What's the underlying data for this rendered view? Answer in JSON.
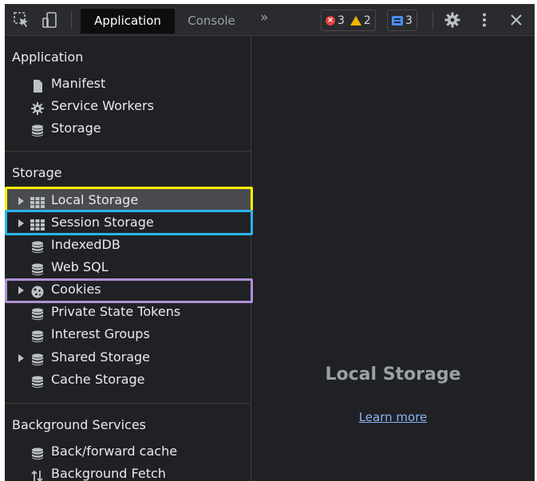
{
  "toolbar": {
    "tabs": [
      {
        "label": "Application",
        "active": true
      },
      {
        "label": "Console",
        "active": false
      }
    ],
    "more_tabs": "»",
    "errors_count": "3",
    "warnings_count": "2",
    "messages_count": "3",
    "icons": [
      "inspect-element-icon",
      "device-toggle-icon",
      "settings-gear-icon",
      "kebab-menu-icon",
      "close-icon"
    ]
  },
  "sidebar": {
    "application": {
      "title": "Application",
      "items": [
        {
          "label": "Manifest",
          "icon": "document-icon"
        },
        {
          "label": "Service Workers",
          "icon": "gear-icon"
        },
        {
          "label": "Storage",
          "icon": "database-icon"
        }
      ]
    },
    "storage": {
      "title": "Storage",
      "items": [
        {
          "label": "Local Storage",
          "icon": "grid-icon",
          "expandable": true,
          "selected": true
        },
        {
          "label": "Session Storage",
          "icon": "grid-icon",
          "expandable": true
        },
        {
          "label": "IndexedDB",
          "icon": "database-icon"
        },
        {
          "label": "Web SQL",
          "icon": "database-icon"
        },
        {
          "label": "Cookies",
          "icon": "cookie-icon",
          "expandable": true
        },
        {
          "label": "Private State Tokens",
          "icon": "database-icon"
        },
        {
          "label": "Interest Groups",
          "icon": "database-icon"
        },
        {
          "label": "Shared Storage",
          "icon": "database-icon",
          "expandable": true
        },
        {
          "label": "Cache Storage",
          "icon": "database-icon"
        }
      ]
    },
    "background_services": {
      "title": "Background Services",
      "items": [
        {
          "label": "Back/forward cache",
          "icon": "database-icon"
        },
        {
          "label": "Background Fetch",
          "icon": "up-down-arrows-icon"
        }
      ]
    }
  },
  "highlights": [
    {
      "target": "Local Storage",
      "color": "#fff200"
    },
    {
      "target": "Session Storage",
      "color": "#2ab4e8"
    },
    {
      "target": "Cookies",
      "color": "#b18fd6"
    }
  ],
  "main": {
    "title": "Local Storage",
    "learn_more": "Learn more"
  },
  "colors": {
    "background": "#202124",
    "text": "#e8eaed",
    "link": "#8ab4f8",
    "selected_row": "#4a4b4e"
  }
}
